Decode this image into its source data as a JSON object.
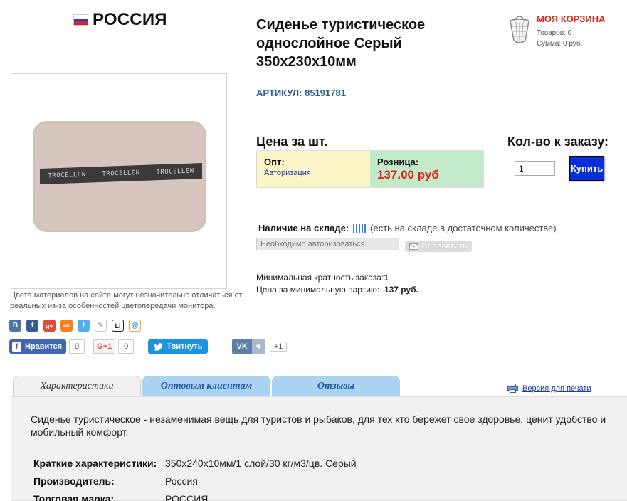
{
  "brand": {
    "name": "РОССИЯ",
    "flag_colors": [
      "#ffffff",
      "#1c3fd6",
      "#e21b1b"
    ]
  },
  "product": {
    "title": "Сиденье туристическое однослойное Серый 350х230х10мм",
    "sku": "АРТИКУЛ: 85191781",
    "image_strap_text": [
      "TROCELLEN",
      "TROCELLEN",
      "TROCELLEN"
    ],
    "image_note": "Цвета материалов на сайте могут незначительно отличаться от реальных из-за особенностей цветопередачи монитора."
  },
  "cart": {
    "title": "МОЯ КОРЗИНА",
    "items_line": "Товаров: 0",
    "sum_line": "Сумма: 0 руб.",
    "icon": "basket-icon"
  },
  "pricing": {
    "heading": "Цена за шт.",
    "qty_heading": "Кол-во к заказу:",
    "wholesale_label": "Опт:",
    "wholesale_link": "Авторизация",
    "retail_label": "Розница:",
    "retail_price": "137.00 руб",
    "qty_value": "1",
    "buy_label": "Купить",
    "accent_price_color": "#d9261c"
  },
  "stock": {
    "label": "Наличие на складе:",
    "text": "(есть на складе в достаточном количестве)",
    "notify_placeholder": "Необходимо авторизоваться",
    "notify_button": "Оповестить"
  },
  "minimums": {
    "multiplicity_label": "Минимальная кратность заказа:",
    "multiplicity_value": "1",
    "min_batch_label": "Цена за минимальную партию:",
    "min_batch_value": "137 руб."
  },
  "social": {
    "icons": [
      {
        "name": "vk-share-icon",
        "glyph": "B",
        "color": "#4d75a3"
      },
      {
        "name": "facebook-share-icon",
        "glyph": "f",
        "color": "#3b5998"
      },
      {
        "name": "gplus-share-icon",
        "glyph": "g+",
        "color": "#dd4b39"
      },
      {
        "name": "odnoklassniki-share-icon",
        "glyph": "ок",
        "color": "#f2811d"
      },
      {
        "name": "twitter-share-icon",
        "glyph": "t",
        "color": "#55acee"
      },
      {
        "name": "livejournal-share-icon",
        "glyph": "✎",
        "color": "#6a8fb5"
      },
      {
        "name": "liveinternet-share-icon",
        "glyph": "Li",
        "color": "#222222"
      },
      {
        "name": "mailru-share-icon",
        "glyph": "@",
        "color": "#168de2"
      }
    ],
    "fb_like_label": "Нравится",
    "fb_count": "0",
    "gplus_label": "G+1",
    "gplus_count": "0",
    "tweet_label": "Твитнуть",
    "vk_label": "VK",
    "vk_count": "+1"
  },
  "tabs": {
    "items": [
      "Характеристики",
      "Оптовым клиентам",
      "Отзывы"
    ],
    "print_label": "Версия для печати"
  },
  "details": {
    "description": "Сиденье туристическое - незаменимая вещь для туристов и рыбаков, для тех кто бережет свое здоровье, ценит удобство и мобильный комфорт.",
    "specs": [
      {
        "key": "Краткие характеристики:",
        "value": "350х240х10мм/1 слой/30 кг/м3/цв. Серый"
      },
      {
        "key": "Производитель:",
        "value": "Россия"
      },
      {
        "key": "Торговая марка:",
        "value": "РОССИЯ"
      }
    ]
  }
}
